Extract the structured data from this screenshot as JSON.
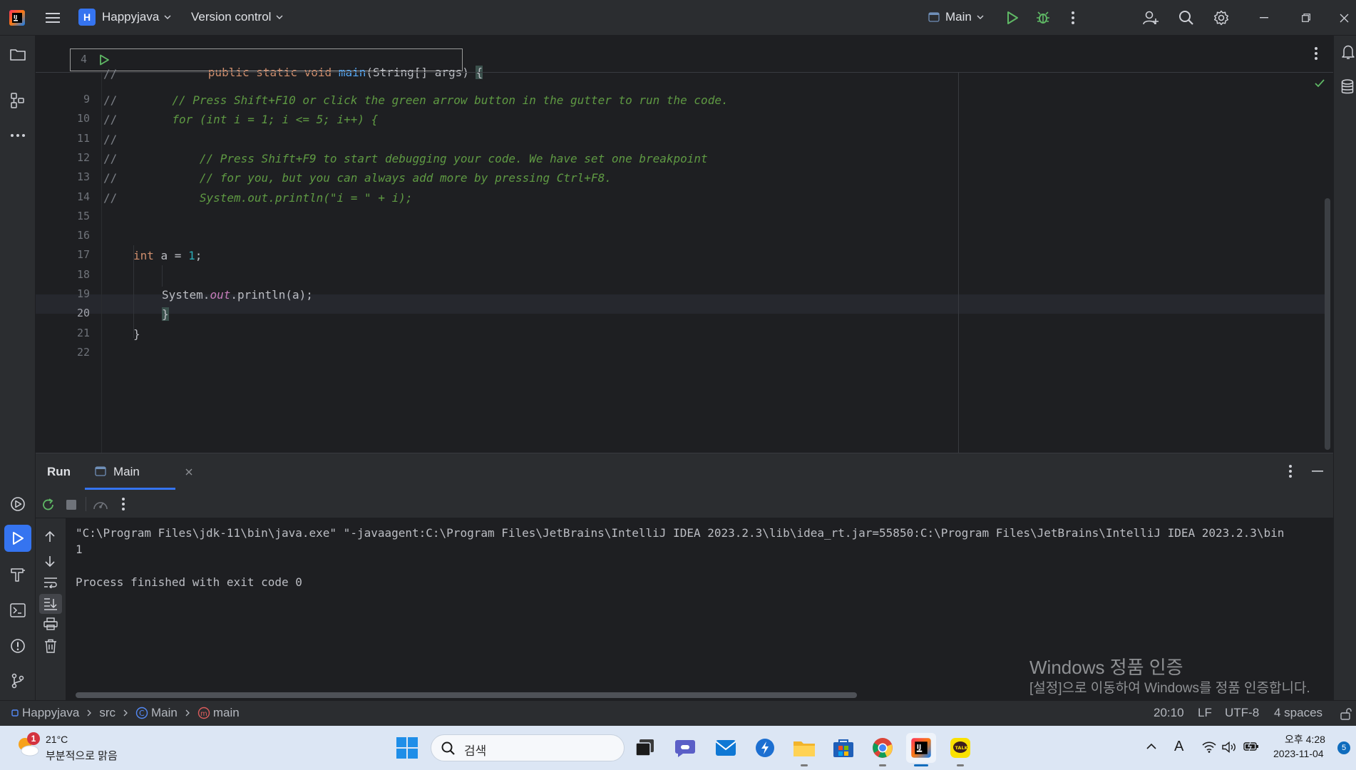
{
  "titlebar": {
    "project_initial": "H",
    "project_name": "Happyjava",
    "vcs_label": "Version control",
    "run_config": "Main"
  },
  "editor": {
    "sticky_line_number": "4",
    "sticky_line": {
      "kw1": "public static void ",
      "fn": "main",
      "rest": "(String[] args) ",
      "brace": "{"
    },
    "lines": [
      {
        "num": "9",
        "slash": "//",
        "text": "        // Press Shift+F10 or click the green arrow button in the gutter to run the code."
      },
      {
        "num": "10",
        "slash": "//",
        "text": "        for (int i = 1; i <= 5; i++) {"
      },
      {
        "num": "11",
        "slash": "//",
        "text": ""
      },
      {
        "num": "12",
        "slash": "//",
        "text": "            // Press Shift+F9 to start debugging your code. We have set one breakpoint"
      },
      {
        "num": "13",
        "slash": "//",
        "text": "            // for you, but you can always add more by pressing Ctrl+F8."
      },
      {
        "num": "14",
        "slash": "//",
        "text": "            System.out.println(\"i = \" + i);"
      },
      {
        "num": "15"
      },
      {
        "num": "16"
      },
      {
        "num": "17",
        "kw": "int",
        "mid": " a = ",
        "num_lit": "1",
        "end": ";"
      },
      {
        "num": "18"
      },
      {
        "num": "19",
        "pre": "System.",
        "stat": "out",
        "post": ".println(a);"
      },
      {
        "num": "20",
        "brace": "}"
      },
      {
        "num": "21",
        "brace": "}"
      },
      {
        "num": "22"
      }
    ]
  },
  "run_panel": {
    "tab_run": "Run",
    "tab_main": "Main",
    "console": [
      "\"C:\\Program Files\\jdk-11\\bin\\java.exe\" \"-javaagent:C:\\Program Files\\JetBrains\\IntelliJ IDEA 2023.2.3\\lib\\idea_rt.jar=55850:C:\\Program Files\\JetBrains\\IntelliJ IDEA 2023.2.3\\bin",
      "1",
      "",
      "Process finished with exit code 0"
    ],
    "windows_activation_title": "Windows 정품 인증",
    "windows_activation_sub": "[설정]으로 이동하여 Windows를 정품 인증합니다."
  },
  "statusbar": {
    "breadcrumbs": [
      "Happyjava",
      "src",
      "Main",
      "main"
    ],
    "position": "20:10",
    "line_sep": "LF",
    "encoding": "UTF-8",
    "indent": "4 spaces"
  },
  "taskbar": {
    "weather_temp": "21°C",
    "weather_desc": "부분적으로 맑음",
    "weather_badge": "1",
    "search_placeholder": "검색",
    "ime": "A",
    "time": "오후 4:28",
    "date": "2023-11-04",
    "notif_count": "5"
  },
  "colors": {
    "accent": "#3574f0",
    "run_green": "#5fb865",
    "comment_green": "#5f9a43"
  }
}
